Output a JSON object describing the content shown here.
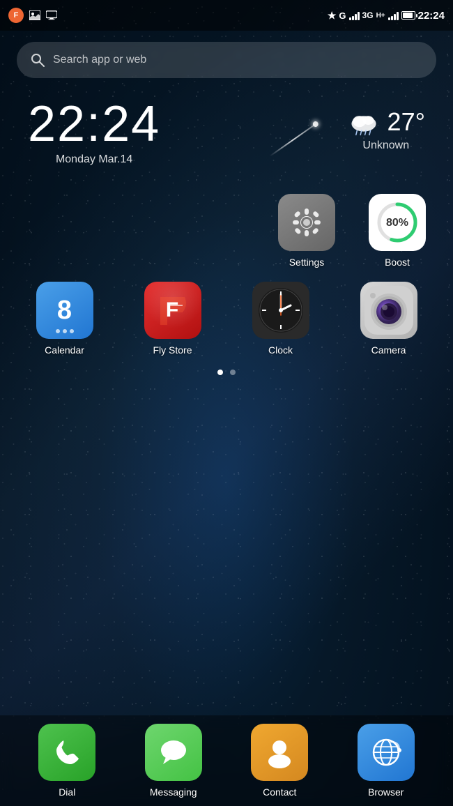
{
  "statusBar": {
    "time": "22:24",
    "network": "G",
    "networkType": "3G",
    "networkPlus": "H+",
    "batteryLevel": 80
  },
  "search": {
    "placeholder": "Search app or web"
  },
  "clock": {
    "time": "22:24",
    "date": "Monday Mar.14"
  },
  "weather": {
    "temp": "27°",
    "location": "Unknown"
  },
  "apps": {
    "row1": [
      {
        "id": "settings",
        "label": "Settings"
      },
      {
        "id": "boost",
        "label": "Boost",
        "value": "80%"
      }
    ],
    "row2": [
      {
        "id": "calendar",
        "label": "Calendar",
        "number": "8"
      },
      {
        "id": "flystore",
        "label": "Fly Store"
      },
      {
        "id": "clock",
        "label": "Clock"
      },
      {
        "id": "camera",
        "label": "Camera"
      }
    ]
  },
  "dock": [
    {
      "id": "dial",
      "label": "Dial"
    },
    {
      "id": "messaging",
      "label": "Messaging"
    },
    {
      "id": "contact",
      "label": "Contact"
    },
    {
      "id": "browser",
      "label": "Browser"
    }
  ],
  "pageDots": [
    {
      "active": true
    },
    {
      "active": false
    }
  ]
}
